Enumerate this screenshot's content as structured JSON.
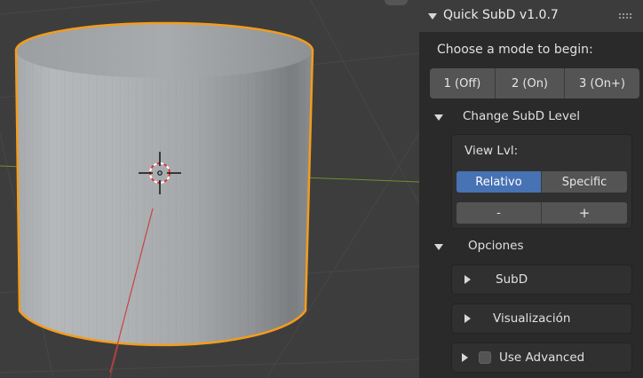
{
  "panel": {
    "title": "Quick SubD v1.0.7",
    "prompt": "Choose a mode to begin:",
    "modes": [
      "1 (Off)",
      "2 (On)",
      "3 (On+)"
    ],
    "change_level": {
      "header": "Change SubD Level",
      "view_label": "View Lvl:",
      "relativo_label": "Relativo",
      "specific_label": "Specific",
      "minus_label": "-",
      "plus_label": "+"
    },
    "opciones": {
      "header": "Opciones",
      "subd_label": "SubD",
      "visualizacion_label": "Visualización",
      "use_advanced_label": "Use Advanced",
      "use_advanced_checked": false
    }
  },
  "icons": {
    "collapse": "triangle-down-icon",
    "expand": "triangle-right-icon",
    "drag": "drag-grip-icon",
    "cursor": "3d-cursor-icon"
  },
  "colors": {
    "panel_bg": "#2a2a2a",
    "header_bg": "#3c3c3c",
    "button_bg": "#545454",
    "active_button": "#4772b3",
    "selection_outline": "#f39c1c",
    "viewport_bg": "#3d3d3d",
    "axis_x": "#8a3f3f",
    "axis_y": "#6f8f32"
  }
}
